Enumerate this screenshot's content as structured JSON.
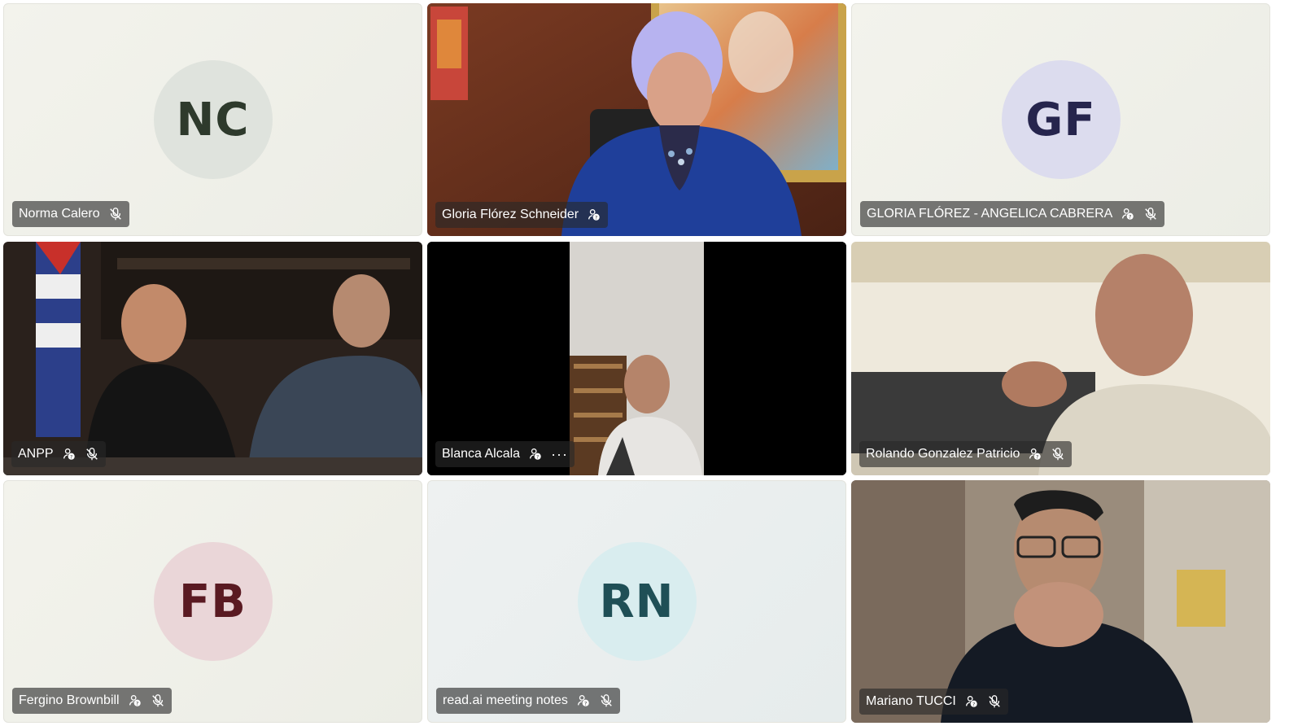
{
  "participants": [
    {
      "name": "Norma Calero",
      "initials": "NC",
      "avatar_bg": "#dfe3dd",
      "avatar_fg": "#2e3a2c",
      "muted": true,
      "badge": false
    },
    {
      "name": "Gloria Flórez Schneider",
      "badge": true,
      "muted": false,
      "active_speaker": true
    },
    {
      "name": "GLORIA FLÓREZ - ANGELICA CABRERA",
      "initials": "GF",
      "avatar_bg": "#dcdcee",
      "avatar_fg": "#26254d",
      "muted": true,
      "badge": true
    },
    {
      "name": "ANPP",
      "muted": true,
      "badge": true
    },
    {
      "name": "Blanca Alcala",
      "badge": true,
      "more": "···"
    },
    {
      "name": "Rolando Gonzalez Patricio",
      "muted": true,
      "badge": true
    },
    {
      "name": "Fergino Brownbill",
      "initials": "FB",
      "avatar_bg": "#ead6d8",
      "avatar_fg": "#5a1a22",
      "muted": true,
      "badge": true
    },
    {
      "name": "read.ai meeting notes",
      "initials": "RN",
      "avatar_bg": "#d9edef",
      "avatar_fg": "#1f4f56",
      "muted": true,
      "badge": true
    },
    {
      "name": "Mariano TUCCI",
      "muted": true,
      "badge": true
    }
  ],
  "colors": {
    "active_outline": "#5b5fc7"
  }
}
